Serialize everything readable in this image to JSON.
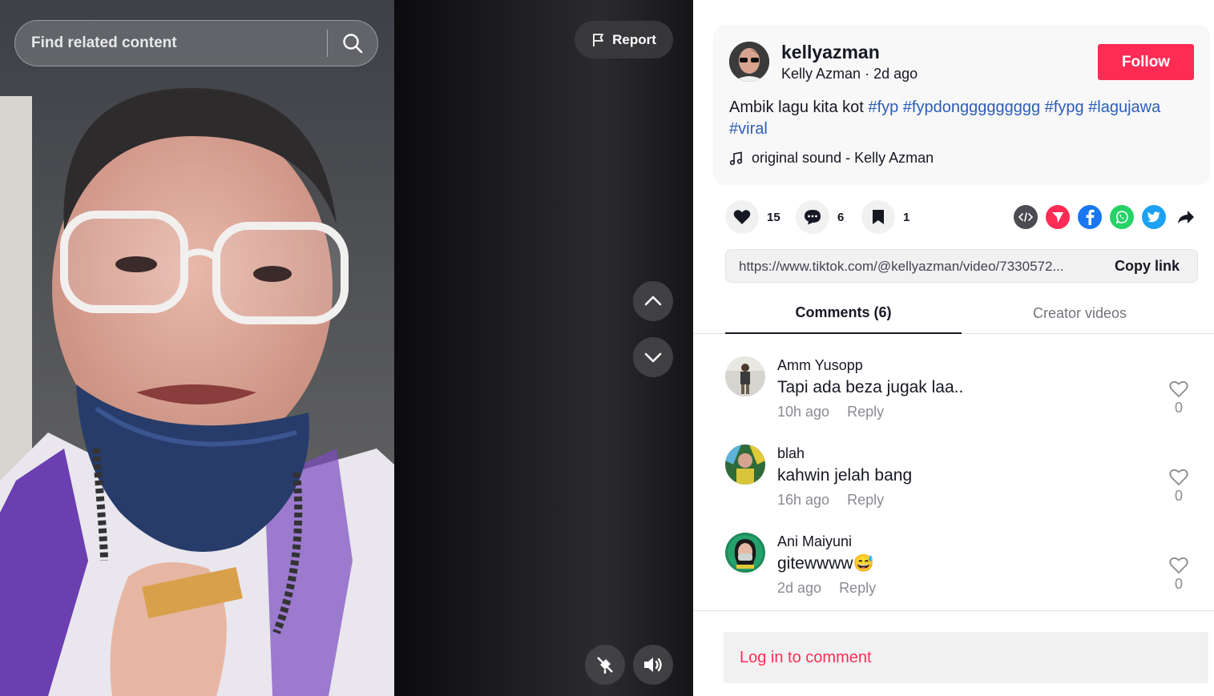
{
  "video": {
    "search_placeholder": "Find related content",
    "report_label": "Report",
    "controls": [
      "chevron-up-icon",
      "chevron-down-icon",
      "no-float-icon",
      "volume-icon"
    ]
  },
  "post": {
    "username": "kellyazman",
    "display_name": "Kelly Azman",
    "separator": "·",
    "posted_ago": "2d ago",
    "follow_label": "Follow",
    "caption_text": "Ambik lagu kita kot",
    "hashtags": [
      "#fyp",
      "#fypdonggggggggg",
      "#fypg",
      "#lagujawa",
      "#viral"
    ],
    "music": "original sound - Kelly Azman"
  },
  "actions": {
    "likes": "15",
    "comments": "6",
    "saves": "1",
    "share_targets": [
      "embed-icon",
      "send-icon",
      "facebook-icon",
      "whatsapp-icon",
      "twitter-icon",
      "share-arrow-icon"
    ]
  },
  "link": {
    "url": "https://www.tiktok.com/@kellyazman/video/7330572...",
    "copy_label": "Copy link"
  },
  "tabs": {
    "comments": "Comments (6)",
    "creator_videos": "Creator videos"
  },
  "comments": [
    {
      "user": "Amm Yusopp",
      "text": "Tapi ada beza jugak laa..",
      "time": "10h ago",
      "reply": "Reply",
      "likes": "0"
    },
    {
      "user": "blah",
      "text": "kahwin jelah bang",
      "time": "16h ago",
      "reply": "Reply",
      "likes": "0"
    },
    {
      "user": "Ani Maiyuni",
      "text": "gitewwww😅",
      "time": "2d ago",
      "reply": "Reply",
      "likes": "0"
    }
  ],
  "login_prompt": "Log in to comment",
  "colors": {
    "brand": "#fe2c55",
    "hashtag": "#2b5db9",
    "text": "#161823",
    "muted": "#8a8b91"
  }
}
